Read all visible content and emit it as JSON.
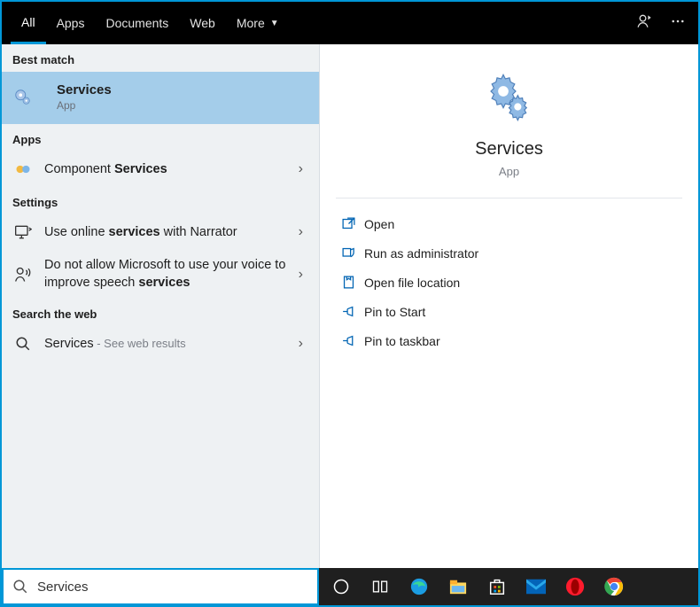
{
  "tabs": {
    "all": "All",
    "apps": "Apps",
    "documents": "Documents",
    "web": "Web",
    "more": "More"
  },
  "sections": {
    "best_match": "Best match",
    "apps": "Apps",
    "settings": "Settings",
    "search_web": "Search the web"
  },
  "best": {
    "title": "Services",
    "subtitle": "App"
  },
  "apps_list": {
    "component_pre": "Component ",
    "component_bold": "Services"
  },
  "settings_list": {
    "sl1_pre": "Use online ",
    "sl1_bold": "services",
    "sl1_post": " with Narrator",
    "sl2_pre": "Do not allow Microsoft to use your voice to improve speech ",
    "sl2_bold": "services"
  },
  "web_list": {
    "name": "Services",
    "suffix": " - See web results"
  },
  "preview": {
    "title": "Services",
    "subtitle": "App"
  },
  "actions": {
    "open": "Open",
    "runadmin": "Run as administrator",
    "fileloc": "Open file location",
    "pinstart": "Pin to Start",
    "pintaskbar": "Pin to taskbar"
  },
  "search": {
    "value": "Services"
  }
}
